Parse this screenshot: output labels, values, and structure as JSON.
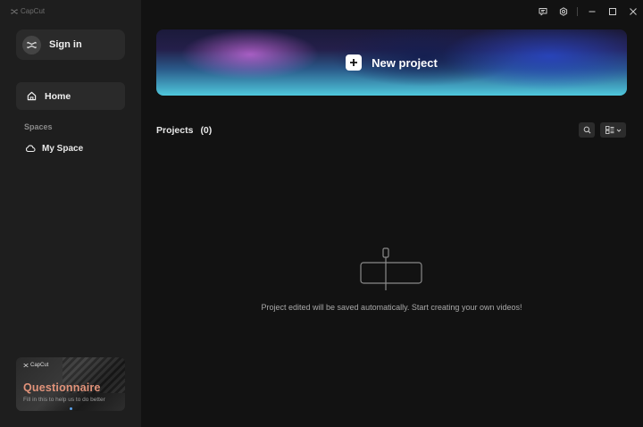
{
  "app": {
    "name": "CapCut"
  },
  "sidebar": {
    "sign_in_label": "Sign in",
    "home_label": "Home",
    "spaces_heading": "Spaces",
    "my_space_label": "My Space",
    "promo": {
      "brand": "CapCut",
      "title": "Questionnaire",
      "subtitle": "Fill in this to help us to do better"
    }
  },
  "topbar": {
    "icons": [
      "feedback-icon",
      "settings-icon",
      "minimize-icon",
      "maximize-icon",
      "close-icon"
    ]
  },
  "hero": {
    "new_project_label": "New project"
  },
  "projects": {
    "heading": "Projects",
    "count": "(0)",
    "empty_message": "Project edited will be saved automatically. Start creating your own videos!"
  },
  "colors": {
    "background": "#121212",
    "sidebar": "#1e1e1e",
    "promo_title": "#e2937a"
  }
}
